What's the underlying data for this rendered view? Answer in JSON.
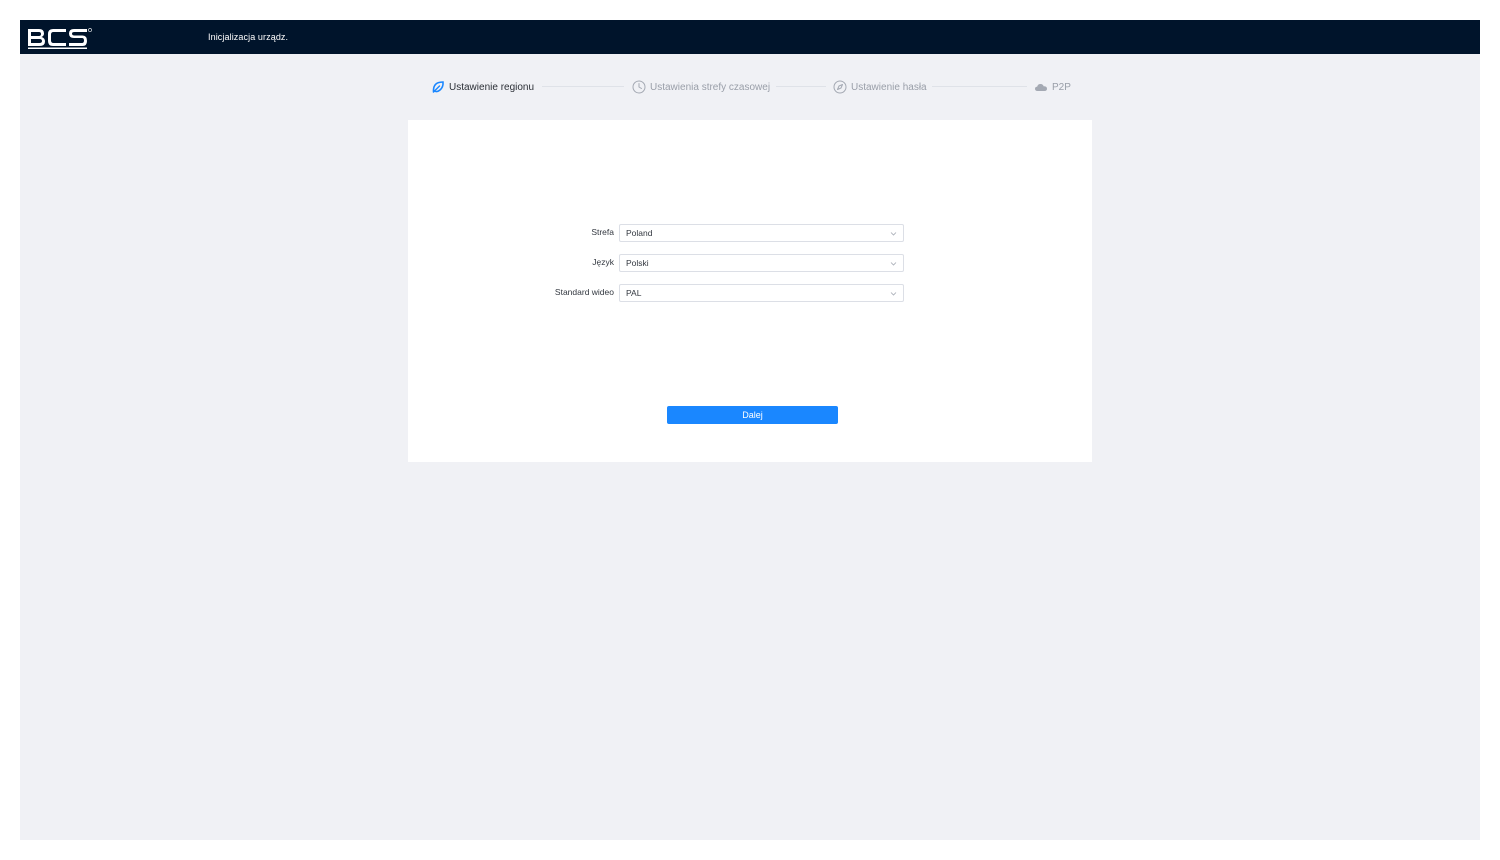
{
  "colors": {
    "topbar_bg": "#00142b",
    "page_bg": "#f0f1f5",
    "accent": "#1a87ff",
    "step_active_text": "#2b2f36",
    "step_inactive_text": "#999ea8"
  },
  "header": {
    "logo_text": "BCS",
    "title": "Inicjalizacja urządz."
  },
  "stepper": {
    "steps": [
      {
        "label": "Ustawienie regionu",
        "icon": "leaf-icon",
        "active": true
      },
      {
        "label": "Ustawienia strefy czasowej",
        "icon": "clock-icon",
        "active": false
      },
      {
        "label": "Ustawienie hasła",
        "icon": "compass-icon",
        "active": false
      },
      {
        "label": "P2P",
        "icon": "cloud-icon",
        "active": false
      }
    ]
  },
  "form": {
    "fields": [
      {
        "label": "Strefa",
        "value": "Poland"
      },
      {
        "label": "Język",
        "value": "Polski"
      },
      {
        "label": "Standard wideo",
        "value": "PAL"
      }
    ],
    "next_label": "Dalej"
  }
}
